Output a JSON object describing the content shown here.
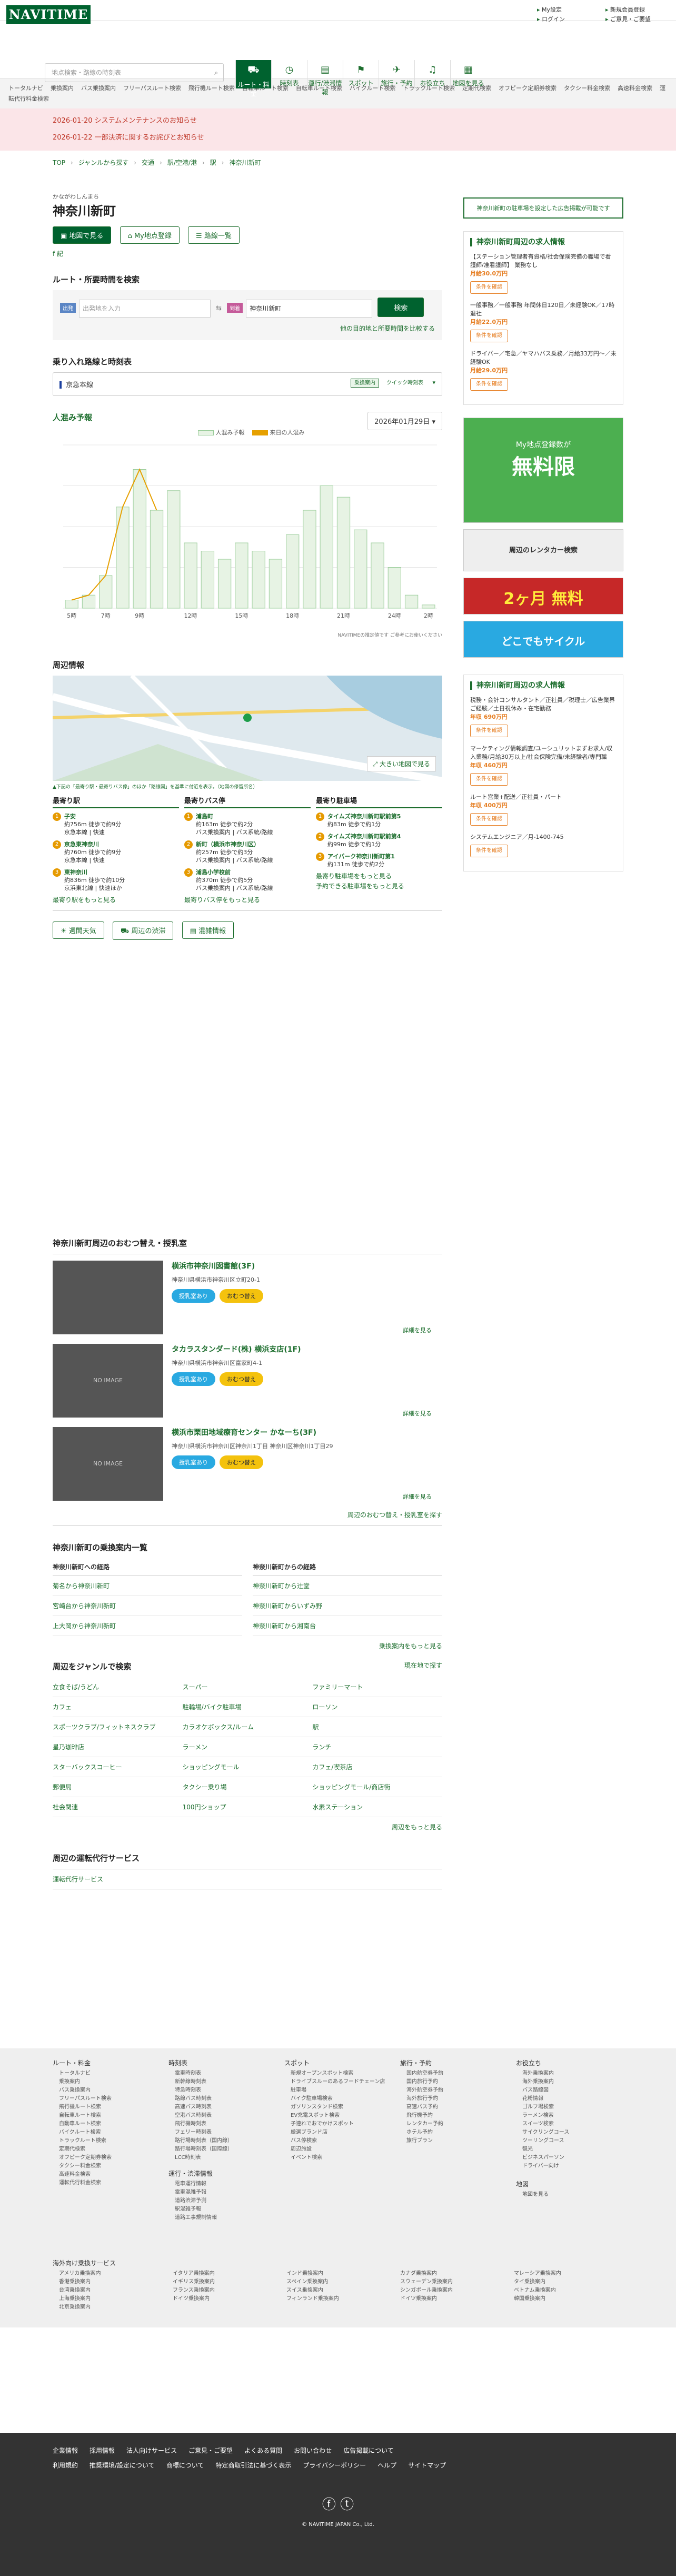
{
  "header": {
    "logo": "NAVITIME",
    "links_a": [
      "My設定",
      "ログイン"
    ],
    "links_b": [
      "新規会員登録",
      "ご意見・ご要望"
    ]
  },
  "search": {
    "placeholder": "地点検索・路線の時刻表"
  },
  "nav": [
    {
      "icon": "⛟",
      "label": "ルート・料金"
    },
    {
      "icon": "◷",
      "label": "時刻表"
    },
    {
      "icon": "▤",
      "label": "運行/渋滞情報"
    },
    {
      "icon": "⚑",
      "label": "スポット"
    },
    {
      "icon": "✈",
      "label": "旅行・予約"
    },
    {
      "icon": "♫",
      "label": "お役立ち"
    },
    {
      "icon": "▦",
      "label": "地図を見る"
    }
  ],
  "cats": [
    "トータルナビ",
    "乗換案内",
    "バス乗換案内",
    "フリーパスルート検索",
    "飛行機ルート検索",
    "自転車ルート検索",
    "自転車ルート検索",
    "バイクルート検索",
    "トラックルート検索",
    "定期代検索",
    "オフピーク定期券検索",
    "タクシー料金検索",
    "高速料金検索",
    "運転代行料金検索"
  ],
  "notices": [
    "2026-01-20 システムメンテナンスのお知らせ",
    "2026-01-22 一部決済に関するお詫びとお知らせ"
  ],
  "breadcrumb": [
    "TOP",
    "ジャンルから探す",
    "交通",
    "駅/空港/港",
    "駅",
    "神奈川新町"
  ],
  "station": {
    "ruby": "かながわしんまち",
    "name": "神奈川新町",
    "btn_map": "地図で見る",
    "btn_my": "My地点登録",
    "btn_list": "路線一覧",
    "share": "f 記"
  },
  "route": {
    "title": "ルート・所要時間を検索",
    "dep_tag": "出発",
    "dep_placeholder": "出発地を入力",
    "dest_tag": "到着",
    "dest_value": "神奈川新町",
    "search_btn": "検索",
    "compare_link": "他の目的地と所要時間を比較する"
  },
  "lines": {
    "title": "乗り入れ路線と時刻表",
    "line": "京急本線",
    "tag": "乗換案内",
    "quick": "クイック時刻表"
  },
  "crowd": {
    "title": "人混み予報",
    "date": "2026年01月29日",
    "legend_a": "人混み予報",
    "legend_b": "来日の人混み",
    "note": "NAVITIMEの推定値です ご参考にお使いください"
  },
  "chart_data": {
    "type": "bar",
    "categories": [
      "5",
      "6",
      "7",
      "8",
      "9",
      "10",
      "11",
      "12",
      "13",
      "14",
      "15",
      "16",
      "17",
      "18",
      "19",
      "20",
      "21",
      "22",
      "23",
      "24",
      "1",
      "2"
    ],
    "values": [
      5,
      8,
      20,
      62,
      85,
      60,
      72,
      40,
      35,
      30,
      40,
      35,
      30,
      45,
      60,
      75,
      68,
      48,
      40,
      25,
      8,
      2
    ],
    "series": [
      {
        "name": "人混み予報",
        "values": [
          5,
          8,
          20,
          62,
          85,
          60,
          72,
          40,
          35,
          30,
          40,
          35,
          30,
          45,
          60,
          75,
          68,
          48,
          40,
          25,
          8,
          2
        ]
      }
    ],
    "xticks": [
      "5時",
      "7時",
      "9時",
      "12時",
      "15時",
      "18時",
      "21時",
      "24時",
      "2時"
    ],
    "ylim": [
      0,
      100
    ],
    "colors": {
      "bar": "#e7f3e4",
      "line": "#e6a000"
    }
  },
  "nearby": {
    "title": "周辺情報",
    "map_btn": "大きい地図で見る",
    "map_note": "▲下記の「最寄り駅・最寄りバス停」のほか「路線図」を基準に付近を表示。（地図の停留所名）",
    "stations": {
      "title": "最寄り駅",
      "items": [
        {
          "n": "1",
          "name": "子安",
          "d": "約756m 徒歩で約9分",
          "s": "京急本線 | 快速"
        },
        {
          "n": "2",
          "name": "京急東神奈川",
          "d": "約760m 徒歩で約9分",
          "s": "京急本線 | 快速"
        },
        {
          "n": "3",
          "name": "東神奈川",
          "d": "約836m 徒歩で約10分",
          "s": "京浜東北線 | 快速ほか"
        }
      ],
      "more": "最寄り駅をもっと見る"
    },
    "bus": {
      "title": "最寄りバス停",
      "items": [
        {
          "n": "1",
          "name": "浦島町",
          "d": "約163m 徒歩で約2分",
          "s": "バス乗換案内 | バス系統/路線"
        },
        {
          "n": "2",
          "name": "新町（横浜市神奈川区）",
          "d": "約257m 徒歩で約3分",
          "s": "バス乗換案内 | バス系統/路線"
        },
        {
          "n": "3",
          "name": "浦島小学校前",
          "d": "約370m 徒歩で約5分",
          "s": "バス乗換案内 | バス系統/路線"
        }
      ],
      "more": "最寄りバス停をもっと見る"
    },
    "parking": {
      "title": "最寄り駐車場",
      "items": [
        {
          "n": "1",
          "name": "タイムズ神奈川新町駅前第5",
          "d": "約83m 徒歩で約1分",
          "s": ""
        },
        {
          "n": "2",
          "name": "タイムズ神奈川新町駅前第4",
          "d": "約99m 徒歩で約1分",
          "s": ""
        },
        {
          "n": "3",
          "name": "アイパーク神奈川新町第1",
          "d": "約131m 徒歩で約2分",
          "s": ""
        }
      ],
      "more": "最寄り駐車場をもっと見る",
      "more2": "予約できる駐車場をもっと見る"
    }
  },
  "buttons": [
    "週間天気",
    "周辺の渋滞",
    "混雑情報"
  ],
  "nursing": {
    "title": "神奈川新町周辺のおむつ替え・授乳室",
    "items": [
      {
        "name": "横浜市神奈川図書館(3F)",
        "addr": "神奈川県横浜市神奈川区立町20-1",
        "img": ""
      },
      {
        "name": "タカラスタンダード(株) 横浜支店(1F)",
        "addr": "神奈川県横浜市神奈川区富家町4-1",
        "img": "NO IMAGE"
      },
      {
        "name": "横浜市栗田地域療育センター かなーち(3F)",
        "addr": "神奈川県横浜市神奈川区神奈川1丁目 神奈川区神奈川1丁目29",
        "img": "NO IMAGE"
      }
    ],
    "chip_a": "授乳室あり",
    "chip_b": "おむつ替え",
    "detail": "詳細を見る",
    "more": "周辺のおむつ替え・授乳室を探す"
  },
  "transfer": {
    "title": "神奈川新町の乗換案内一覧",
    "to_title": "神奈川新町への経路",
    "from_title": "神奈川新町からの経路",
    "to": [
      "菊名から神奈川新町",
      "宮崎台から神奈川新町",
      "上大岡から神奈川新町"
    ],
    "from": [
      "神奈川新町から辻堂",
      "神奈川新町からいずみ野",
      "神奈川新町から湘南台"
    ],
    "more": "乗換案内をもっと見る"
  },
  "genre": {
    "title": "周辺をジャンルで検索",
    "here": "現在地で探す",
    "items": [
      "立食そば/うどん",
      "スーパー",
      "ファミリーマート",
      "カフェ",
      "駐輪場/バイク駐車場",
      "ローソン",
      "スポーツクラブ/フィットネスクラブ",
      "カラオケボックス/ルーム",
      "駅",
      "星乃珈琲店",
      "ラーメン",
      "ランチ",
      "スターバックスコーヒー",
      "ショッピングモール",
      "カフェ/喫茶店",
      "郵便局",
      "タクシー乗り場",
      "ショッピングモール/商店街",
      "社会関連",
      "100円ショップ",
      "水素ステーション"
    ],
    "more": "周辺をもっと見る"
  },
  "proxy": {
    "title": "周辺の運転代行サービス",
    "link": "運転代行サービス"
  },
  "sidebar": {
    "ad_btn": "神奈川新町の駐車場を設定した広告掲載が可能です",
    "job_title": "神奈川新町周辺の求人情報",
    "jobs": [
      {
        "t": "【ステーション管理者有資格/社会保険完備の職場で看護師/准看護師】 業務なし",
        "pay": "月給30.0万円"
      },
      {
        "t": "一般事務／一般事務 年間休日120日／未経験OK／17時退社",
        "pay": "月給22.0万円"
      },
      {
        "t": "ドライバー／宅急／ヤマハバス乗務／月給33万円〜／未経験OK",
        "pay": "月給29.0万円"
      }
    ],
    "job_btn": "条件を確認",
    "ad_free": "無料限",
    "ad_free_sub": "My地点登録数が",
    "ad_rent": "周辺のレンタカー検索",
    "ad_premium": "2ヶ月 無料",
    "ad_cycle": "どこでもサイクル",
    "job_title2": "神奈川新町周辺の求人情報",
    "jobs2": [
      {
        "t": "税務・会計コンサルタント／正社員／税理士／広告業界ご経験／土日祝休み・在宅勤務",
        "pay": "年収 690万円"
      },
      {
        "t": "マーケティング情報調査/ユーシュリットまずお求人/収入業務/月給30万以上/社会保険完備/未経験者/専門職",
        "pay": "年収 460万円"
      },
      {
        "t": "ルート営業+配送／正社員・パート",
        "pay": "年収 400万円"
      },
      {
        "t": "システムエンジニア／月-1400-745",
        "pay": ""
      }
    ]
  },
  "footer": {
    "cols": [
      {
        "h": "ルート・料金",
        "items": [
          "トータルナビ",
          "乗換案内",
          "バス乗換案内",
          "フリーパスルート検索",
          "飛行機ルート検索",
          "自転車ルート検索",
          "自動車ルート検索",
          "バイクルート検索",
          "トラックルート検索",
          "定期代検索",
          "オフピーク定期券検索",
          "タクシー料金検索",
          "高速料金検索",
          "運転代行料金検索"
        ]
      },
      {
        "h": "時刻表",
        "items": [
          "電車時刻表",
          "新幹線時刻表",
          "特急時刻表",
          "路線バス時刻表",
          "高速バス時刻表",
          "空港バス時刻表",
          "飛行機時刻表",
          "フェリー時刻表",
          "路行場時刻表（国内線）",
          "路行場時刻表（国際線）",
          "LCC時刻表"
        ]
      },
      {
        "h": "スポット",
        "items": [
          "新規オープンスポット検索",
          "ドライブスルーのあるフードチェーン店",
          "駐車場",
          "バイク駐車場検索",
          "ガソリンスタンド検索",
          "EV充電スポット検索",
          "子連れでおでかけスポット",
          "厳選ブランド店",
          "バス停検索",
          "周辺施設",
          "イベント検索"
        ]
      },
      {
        "h": "旅行・予約",
        "items": [
          "国内航空券予約",
          "国内旅行予約",
          "海外航空券予約",
          "海外旅行予約",
          "高速バス予約",
          "飛行機予約",
          "レンタカー予約",
          "ホテル予約",
          "旅行プラン"
        ]
      },
      {
        "h": "お役立ち",
        "items": [
          "海外乗換案内",
          "海外乗換案内",
          "バス路線図",
          "花粉情報",
          "ゴルフ場検索",
          "ラーメン検索",
          "スイーツ検索",
          "サイクリングコース",
          "ツーリングコース",
          "観光",
          "ビジネスパーソン",
          "ドライバー向け"
        ]
      }
    ],
    "col_extra": {
      "h": "運行・渋滞情報",
      "items": [
        "電車運行情報",
        "電車混雑予報",
        "道路渋滞予測",
        "駅混雑予報",
        "道路工事規制情報"
      ]
    },
    "map": {
      "h": "地図",
      "items": [
        "地図を見る"
      ]
    },
    "overseas": {
      "h": "海外向け乗換サービス",
      "items": [
        "アメリカ乗換案内",
        "イタリア乗換案内",
        "インド乗換案内",
        "カナダ乗換案内",
        "マレーシア乗換案内",
        "香港乗換案内",
        "イギリス乗換案内",
        "スペイン乗換案内",
        "スウェーデン乗換案内",
        "タイ乗換案内",
        "台湾乗換案内",
        "フランス乗換案内",
        "スイス乗換案内",
        "シンガポール乗換案内",
        "ベトナム乗換案内",
        "上海乗換案内",
        "ドイツ乗換案内",
        "フィンランド乗換案内",
        "ドイツ乗換案内",
        "韓国乗換案内",
        "北京乗換案内"
      ]
    },
    "bottom_a": [
      "企業情報",
      "採用情報",
      "法人向けサービス",
      "ご意見・ご要望",
      "よくある質問",
      "お問い合わせ",
      "広告掲載について"
    ],
    "bottom_b": [
      "利用規約",
      "推奨環境/設定について",
      "商標について",
      "特定商取引法に基づく表示",
      "プライバシーポリシー",
      "ヘルプ",
      "サイトマップ"
    ],
    "copy": "© NAVITIME JAPAN Co., Ltd."
  }
}
